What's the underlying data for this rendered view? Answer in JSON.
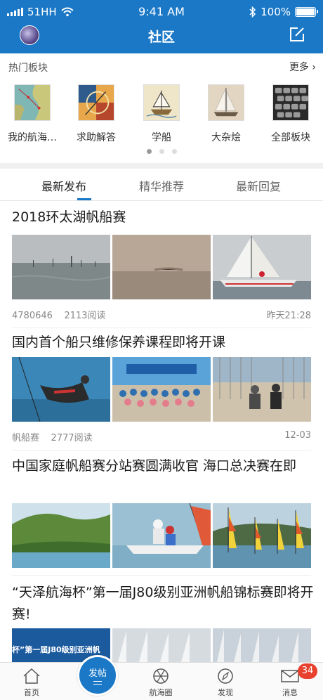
{
  "status_bar": {
    "carrier": "51HH",
    "time": "9:41 AM",
    "battery": "100%"
  },
  "nav": {
    "title": "社区"
  },
  "hot_boards": {
    "title": "热门板块",
    "more": "更多",
    "items": [
      {
        "label": "我的航海…",
        "icon": "nautical-map-thumb"
      },
      {
        "label": "求助解答",
        "icon": "sailing-chart-thumb"
      },
      {
        "label": "学船",
        "icon": "sailboat-drawing-thumb"
      },
      {
        "label": "大杂烩",
        "icon": "sailboat-photo-thumb"
      },
      {
        "label": "全部板块",
        "icon": "keyboard-grid-thumb"
      }
    ]
  },
  "tabs": [
    {
      "label": "最新发布",
      "active": true
    },
    {
      "label": "精华推荐",
      "active": false
    },
    {
      "label": "最新回复",
      "active": false
    }
  ],
  "posts": [
    {
      "title": "2018环太湖帆船赛",
      "meta_left": "4780646",
      "views": "2113阅读",
      "time": "昨天21:28"
    },
    {
      "title": "国内首个船只维修保养课程即将开课",
      "meta_left": "帆船赛",
      "views": "2777阅读",
      "time": "12-03"
    },
    {
      "title": "中国家庭帆船赛分站赛圆满收官 海口总决赛在即"
    },
    {
      "title": "“天泽航海杯”第一届J80级别亚洲帆船锦标赛即将开赛!",
      "banner_text": "杯”第一届J80级别亚洲帆"
    }
  ],
  "bottom_tabs": [
    {
      "label": "首页",
      "icon": "home-icon"
    },
    {
      "label": "发帖",
      "icon": "post-icon"
    },
    {
      "label": "航海圈",
      "icon": "aperture-icon"
    },
    {
      "label": "发现",
      "icon": "compass-icon"
    },
    {
      "label": "消息",
      "icon": "mail-icon",
      "badge": "34"
    }
  ],
  "colors": {
    "primary": "#1a78c7",
    "badge": "#e8412e"
  }
}
